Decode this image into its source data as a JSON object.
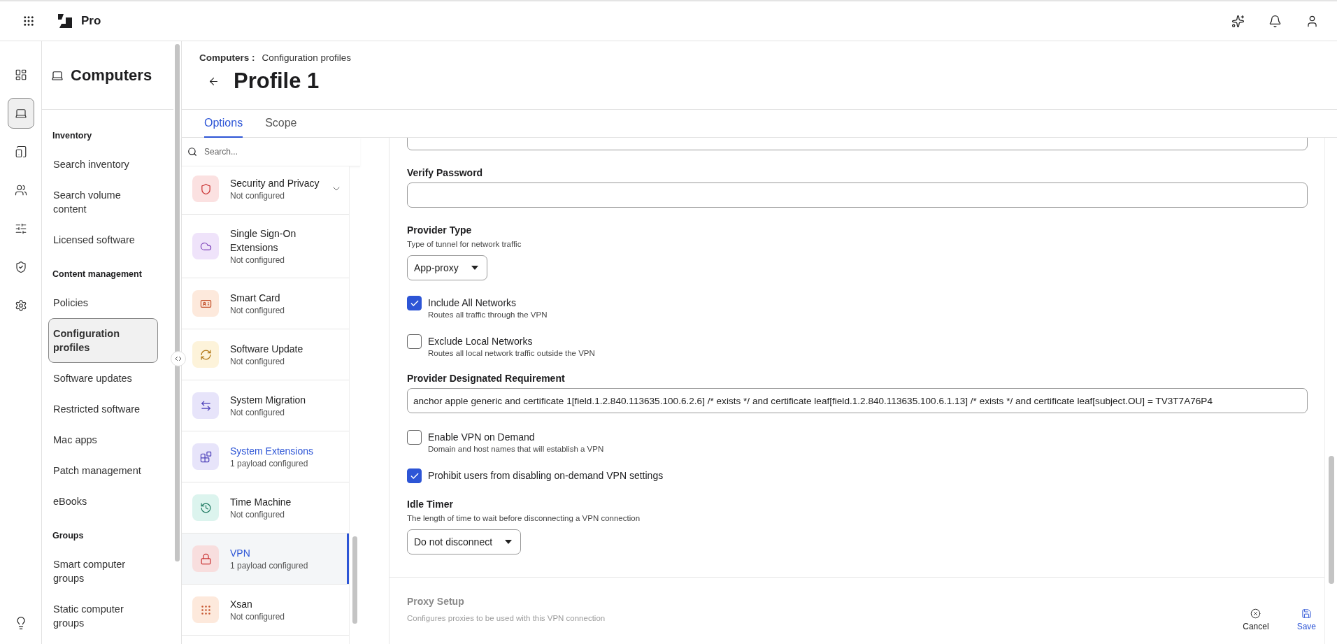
{
  "topbar": {
    "product": "Pro",
    "actions": [
      {
        "kind": "sparkles"
      },
      {
        "kind": "bell"
      },
      {
        "kind": "user"
      }
    ]
  },
  "rail": {
    "items": [
      {
        "kind": "dashboard",
        "selected": false
      },
      {
        "kind": "laptop",
        "selected": true
      },
      {
        "kind": "devices",
        "selected": false
      },
      {
        "kind": "users",
        "selected": false
      },
      {
        "kind": "sliders",
        "selected": false
      },
      {
        "kind": "shield",
        "selected": false
      },
      {
        "kind": "settings",
        "selected": false
      }
    ],
    "bottom": {
      "kind": "lightbulb"
    }
  },
  "nav": {
    "title": "Computers",
    "sections": [
      {
        "heading": "Inventory",
        "items": [
          {
            "label": "Search inventory",
            "selected": false
          },
          {
            "label": "Search volume content",
            "selected": false
          },
          {
            "label": "Licensed software",
            "selected": false
          }
        ]
      },
      {
        "heading": "Content management",
        "items": [
          {
            "label": "Policies",
            "selected": false
          },
          {
            "label": "Configuration profiles",
            "selected": true
          },
          {
            "label": "Software updates",
            "selected": false
          },
          {
            "label": "Restricted software",
            "selected": false
          },
          {
            "label": "Mac apps",
            "selected": false
          },
          {
            "label": "Patch management",
            "selected": false
          },
          {
            "label": "eBooks",
            "selected": false
          }
        ]
      },
      {
        "heading": "Groups",
        "items": [
          {
            "label": "Smart computer groups",
            "selected": false
          },
          {
            "label": "Static computer groups",
            "selected": false
          }
        ]
      }
    ]
  },
  "breadcrumb": {
    "parent": "Computers :",
    "current": "Configuration profiles"
  },
  "title": "Profile 1",
  "tabs": [
    {
      "label": "Options",
      "selected": true
    },
    {
      "label": "Scope",
      "selected": false
    }
  ],
  "payload_search": {
    "placeholder": "Search..."
  },
  "payloads": [
    {
      "kind": "shield",
      "name": "Security and Privacy",
      "status": "Not configured",
      "color": "#fbe1e1",
      "configured": false,
      "selected": false,
      "expandable": true
    },
    {
      "kind": "cloud",
      "name": "Single Sign-On Extensions",
      "status": "Not configured",
      "color": "#efe3fa",
      "configured": false,
      "selected": false,
      "expandable": false
    },
    {
      "kind": "card",
      "name": "Smart Card",
      "status": "Not configured",
      "color": "#fde9dc",
      "configured": false,
      "selected": false,
      "expandable": false
    },
    {
      "kind": "update",
      "name": "Software Update",
      "status": "Not configured",
      "color": "#fdf3da",
      "configured": false,
      "selected": false,
      "expandable": false
    },
    {
      "kind": "migration",
      "name": "System Migration",
      "status": "Not configured",
      "color": "#e7e4fa",
      "configured": false,
      "selected": false,
      "expandable": false
    },
    {
      "kind": "extensions",
      "name": "System Extensions",
      "status": "1 payload configured",
      "color": "#e7e4fa",
      "configured": true,
      "selected": false,
      "expandable": false
    },
    {
      "kind": "history",
      "name": "Time Machine",
      "status": "Not configured",
      "color": "#dcf4ee",
      "configured": false,
      "selected": false,
      "expandable": false
    },
    {
      "kind": "lock",
      "name": "VPN",
      "status": "1 payload configured",
      "color": "#f8dede",
      "configured": true,
      "selected": true,
      "expandable": false
    },
    {
      "kind": "dots",
      "name": "Xsan",
      "status": "Not configured",
      "color": "#fde9dc",
      "configured": false,
      "selected": false,
      "expandable": false
    }
  ],
  "form": {
    "fields": [
      {
        "kind": "input"
      },
      {
        "kind": "input",
        "label": "Verify Password"
      },
      {
        "kind": "select",
        "label": "Provider Type",
        "hint": "Type of tunnel for network traffic",
        "value": "App-proxy"
      },
      {
        "kind": "checkbox",
        "label": "Include All Networks",
        "hint": "Routes all traffic through the VPN",
        "checked": true
      },
      {
        "kind": "checkbox",
        "label": "Exclude Local Networks",
        "hint": "Routes all local network traffic outside the VPN",
        "checked": false
      },
      {
        "kind": "input",
        "label": "Provider Designated Requirement",
        "value": "anchor apple generic and certificate 1[field.1.2.840.113635.100.6.2.6] /* exists */ and certificate leaf[field.1.2.840.113635.100.6.1.13] /* exists */ and certificate leaf[subject.OU] = TV3T7A76P4"
      },
      {
        "kind": "checkbox",
        "label": "Enable VPN on Demand",
        "hint": "Domain and host names that will establish a VPN",
        "checked": false
      },
      {
        "kind": "checkbox",
        "label": "Prohibit users from disabling on-demand VPN settings",
        "checked": true
      },
      {
        "kind": "select",
        "label": "Idle Timer",
        "hint": "The length of time to wait before disconnecting a VPN connection",
        "value": "Do not disconnect"
      }
    ],
    "next_section": {
      "title": "Proxy Setup",
      "subtitle": "Configures proxies to be used with this VPN connection"
    }
  },
  "actions": [
    {
      "kind": "cancel",
      "label": "Cancel"
    },
    {
      "kind": "save",
      "label": "Save"
    }
  ]
}
